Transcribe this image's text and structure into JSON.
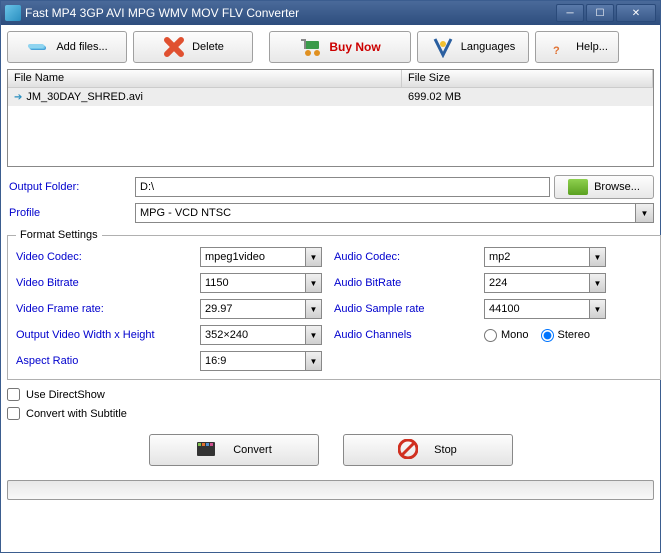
{
  "window": {
    "title": "Fast MP4 3GP AVI MPG WMV MOV FLV Converter"
  },
  "toolbar": {
    "add": "Add files...",
    "delete": "Delete",
    "buy": "Buy Now",
    "lang": "Languages",
    "help": "Help..."
  },
  "filelist": {
    "col_name": "File Name",
    "col_size": "File Size",
    "rows": [
      {
        "name": "JM_30DAY_SHRED.avi",
        "size": "699.02 MB"
      }
    ]
  },
  "output": {
    "folder_label": "Output Folder:",
    "folder_value": "D:\\",
    "browse": "Browse...",
    "profile_label": "Profile",
    "profile_value": "MPG - VCD NTSC"
  },
  "format": {
    "legend": "Format Settings",
    "video_codec_label": "Video Codec:",
    "video_codec": "mpeg1video",
    "video_bitrate_label": "Video Bitrate",
    "video_bitrate": "1150",
    "video_framerate_label": "Video Frame rate:",
    "video_framerate": "29.97",
    "video_size_label": "Output Video Width x Height",
    "video_size": "352×240",
    "aspect_label": "Aspect Ratio",
    "aspect": "16:9",
    "audio_codec_label": "Audio Codec:",
    "audio_codec": "mp2",
    "audio_bitrate_label": "Audio BitRate",
    "audio_bitrate": "224",
    "audio_sample_label": "Audio Sample rate",
    "audio_sample": "44100",
    "audio_channels_label": "Audio Channels",
    "mono": "Mono",
    "stereo": "Stereo"
  },
  "checks": {
    "directshow": "Use DirectShow",
    "subtitle": "Convert with Subtitle"
  },
  "actions": {
    "convert": "Convert",
    "stop": "Stop"
  }
}
